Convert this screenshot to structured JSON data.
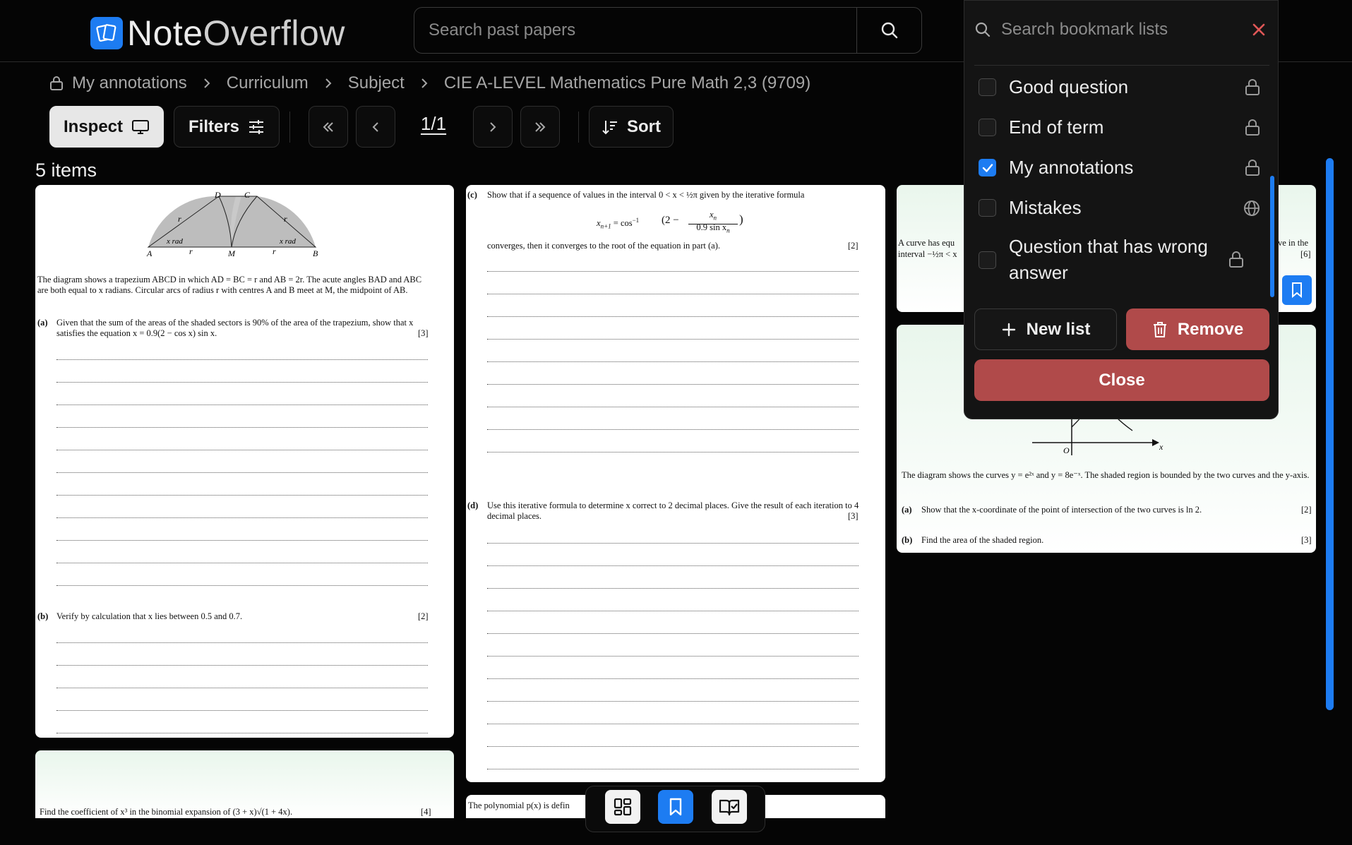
{
  "app": {
    "name_part1": "Note",
    "name_part2": "Overflow"
  },
  "search": {
    "placeholder": "Search past papers"
  },
  "breadcrumb": [
    "My annotations",
    "Curriculum",
    "Subject",
    "CIE A-LEVEL Mathematics Pure Math 2,3 (9709)"
  ],
  "toolbar": {
    "inspect_label": "Inspect",
    "filters_label": "Filters",
    "page": "1/1",
    "sort_label": "Sort"
  },
  "results": {
    "count_label": "5 items"
  },
  "cards": {
    "c1": {
      "labels": {
        "D": "D",
        "C": "C",
        "A": "A",
        "M": "M",
        "B": "B",
        "r": "r",
        "xrad": "x rad"
      },
      "intro": "The diagram shows a trapezium ABCD in which AD = BC = r and AB = 2r. The acute angles BAD and ABC are both equal to x radians. Circular arcs of radius r with centres A and B meet at M, the midpoint of AB.",
      "a_label": "(a)",
      "a_text": "Given that the sum of the areas of the shaded sectors is 90% of the area of the trapezium, show that x satisfies the equation x = 0.9(2 − cos x) sin x.",
      "a_mark": "[3]",
      "b_label": "(b)",
      "b_text": "Verify by calculation that x lies between 0.5 and 0.7.",
      "b_mark": "[2]"
    },
    "c2": {
      "c_label": "(c)",
      "c_text": "Show that if a sequence of values in the interval 0 < x < ½π given by the iterative formula",
      "formula_lhs": "x",
      "formula_sub": "n+1",
      "formula_mid": " = cos",
      "formula_sup": "−1",
      "formula_paren": "(2 −",
      "formula_num": "x",
      "formula_num_sub": "n",
      "formula_den": "0.9 sin x",
      "formula_den_sub": "n",
      "formula_close": ")",
      "c_text2": "converges, then it converges to the root of the equation in part (a).",
      "c_mark": "[2]",
      "d_label": "(d)",
      "d_text": "Use this iterative formula to determine x correct to 2 decimal places. Give the result of each iteration to 4 decimal places.",
      "d_mark": "[3]"
    },
    "c3": {
      "text1": "A curve has equ",
      "text1b": "ve in the",
      "text2": "interval −½π < x",
      "mark": "[6]"
    },
    "c4": {
      "axis_x": "x",
      "axis_o": "O",
      "intro": "The diagram shows the curves y = e²ˣ and y = 8e⁻ˣ. The shaded region is bounded by the two curves and the y-axis.",
      "a_label": "(a)",
      "a_text": "Show that the x-coordinate of the point of intersection of the two curves is ln 2.",
      "a_mark": "[2]",
      "b_label": "(b)",
      "b_text": "Find the area of the shaded region.",
      "b_mark": "[3]"
    },
    "c5": {
      "text": "Find the coefficient of x³ in the binomial expansion of (3 + x)√(1 + 4x).",
      "mark": "[4]"
    },
    "c6": {
      "text": "The polynomial p(x) is defin"
    }
  },
  "bookmarks": {
    "search_placeholder": "Search bookmark lists",
    "lists": [
      {
        "label": "Good question",
        "checked": false,
        "visibility": "lock-icon"
      },
      {
        "label": "End of term",
        "checked": false,
        "visibility": "lock-icon"
      },
      {
        "label": "My annotations",
        "checked": true,
        "visibility": "lock-icon"
      },
      {
        "label": "Mistakes",
        "checked": false,
        "visibility": "globe-icon"
      },
      {
        "label": "Question that has wrong answer",
        "checked": false,
        "visibility": "lock-icon"
      }
    ],
    "new_list_label": "New list",
    "remove_label": "Remove",
    "close_label": "Close"
  },
  "colors": {
    "accent": "#1d7cf2",
    "danger": "#b04a4a",
    "background": "#050505"
  }
}
